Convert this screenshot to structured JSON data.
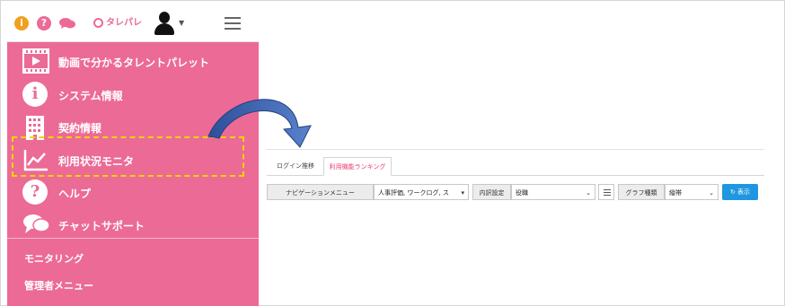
{
  "topbar": {
    "info_icon": "i",
    "help_icon": "?",
    "brand": "タレパレ"
  },
  "sidebar": {
    "items": [
      {
        "label": "動画で分かるタレントパレット",
        "icon": "video-icon"
      },
      {
        "label": "システム情報",
        "icon": "info-icon"
      },
      {
        "label": "契約情報",
        "icon": "building-icon"
      },
      {
        "label": "利用状況モニタ",
        "icon": "line-chart-icon"
      },
      {
        "label": "ヘルプ",
        "icon": "help-icon"
      },
      {
        "label": "チャットサポート",
        "icon": "chat-icon"
      }
    ],
    "sub_items": [
      {
        "label": "モニタリング"
      },
      {
        "label": "管理者メニュー"
      }
    ],
    "info_glyph": "i",
    "help_glyph": "?"
  },
  "colors": {
    "sidebar": "#ec6a96",
    "highlight": "#f2d300",
    "arrow": "#3a5fa8",
    "active_tab": "#ec3b6f",
    "button": "#1f97e0"
  },
  "main": {
    "tabs": [
      {
        "label": "ログイン推移",
        "active": false
      },
      {
        "label": "利用機能ランキング",
        "active": true
      }
    ],
    "toolbar": {
      "nav_menu_label": "ナビゲーションメニュー",
      "nav_menu_value": "人事評価, ワークログ, ス",
      "breakdown_label": "内訳設定",
      "breakdown_value": "役職",
      "graph_type_label": "グラフ種類",
      "graph_type_value": "縦帯",
      "show_button": "表示"
    }
  }
}
